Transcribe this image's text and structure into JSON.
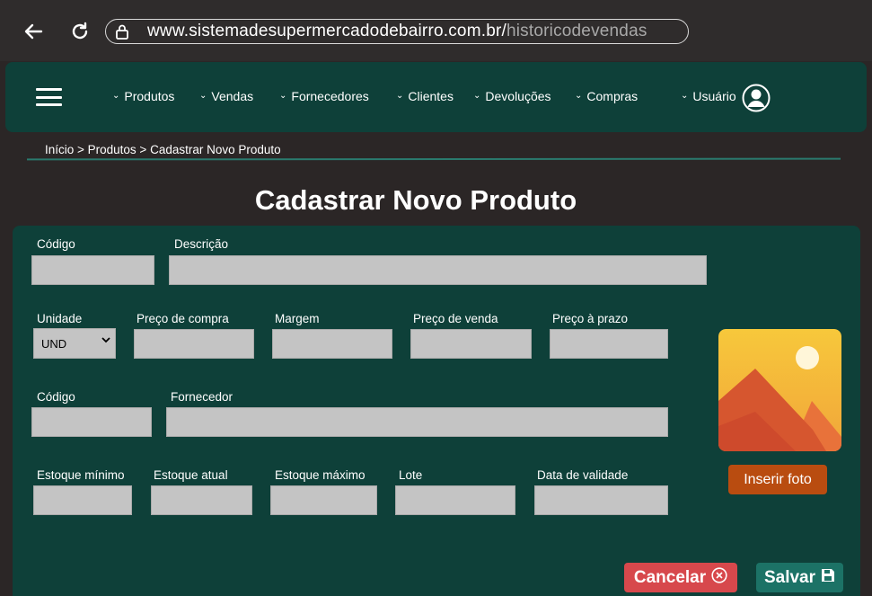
{
  "browser": {
    "url_domain": "www.sistemadesupermercadodebairro.com.br/",
    "url_path": "historicodevendas"
  },
  "menu": {
    "items": [
      {
        "label": "Produtos"
      },
      {
        "label": "Vendas"
      },
      {
        "label": "Fornecedores"
      },
      {
        "label": "Clientes"
      },
      {
        "label": "Devoluções"
      },
      {
        "label": "Compras"
      },
      {
        "label": "Usuário"
      }
    ]
  },
  "breadcrumb": "Início > Produtos > Cadastrar Novo Produto",
  "page_title": "Cadastrar Novo Produto",
  "form": {
    "codigo_label": "Código",
    "descricao_label": "Descrição",
    "unidade_label": "Unidade",
    "unidade_value": "UND",
    "preco_compra_label": "Preço de compra",
    "margem_label": "Margem",
    "preco_venda_label": "Preço de venda",
    "preco_prazo_label": "Preço à prazo",
    "codigo2_label": "Código",
    "fornecedor_label": "Fornecedor",
    "estoque_min_label": "Estoque mínimo",
    "estoque_atual_label": "Estoque atual",
    "estoque_max_label": "Estoque máximo",
    "lote_label": "Lote",
    "validade_label": "Data de validade"
  },
  "photo": {
    "button_label": "Inserir foto"
  },
  "actions": {
    "cancel_label": "Cancelar",
    "save_label": "Salvar"
  },
  "colors": {
    "page_bg": "#2b2626",
    "panel": "#0e4039",
    "field": "#c4c4c4",
    "cancel": "#d7484c",
    "save": "#1c7266",
    "photo_button": "#b94c10"
  }
}
